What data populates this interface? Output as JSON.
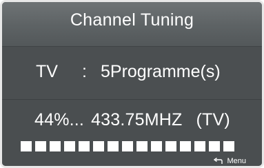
{
  "title": "Channel Tuning",
  "tv_row": {
    "label": "TV",
    "colon": ":",
    "count_text": "5Programme(s)"
  },
  "scan_row": {
    "percent_text": "44%...",
    "frequency_text": "433.75MHZ",
    "source_text": "(TV)"
  },
  "progress": {
    "segments_filled": 15,
    "segments_total": 15
  },
  "menu_hint": {
    "icon": "return-arrow-icon",
    "label": "Menu"
  },
  "colors": {
    "panel": "#505456",
    "header": "#5d6264",
    "border": "#e8e8e8",
    "text": "#ffffff"
  }
}
